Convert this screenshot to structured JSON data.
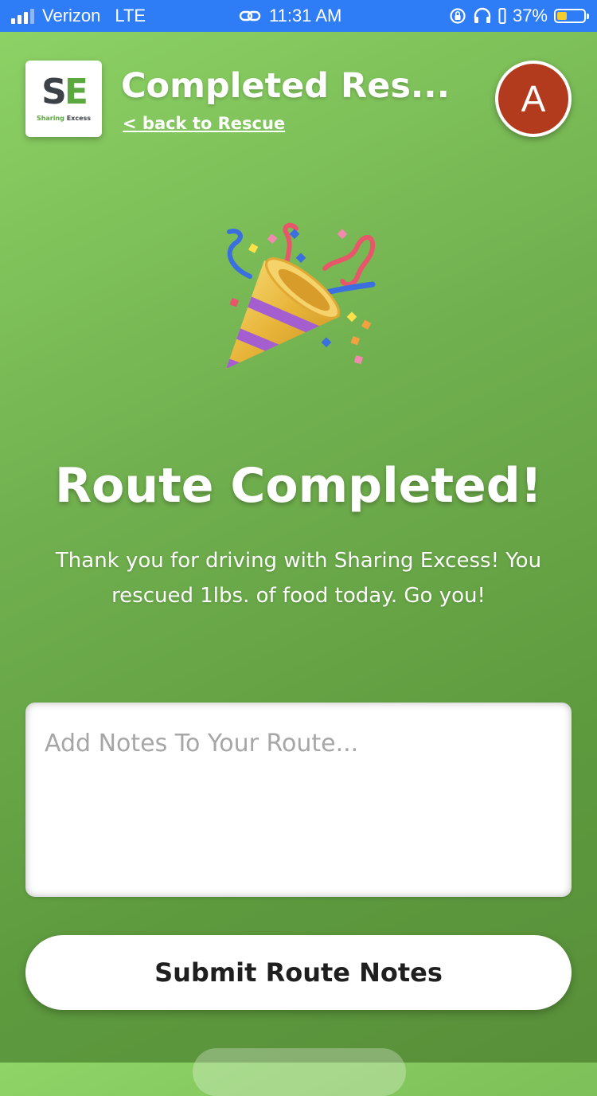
{
  "status_bar": {
    "carrier": "Verizon",
    "network": "LTE",
    "time": "11:31 AM",
    "battery": "37%",
    "battery_level": 0.37,
    "battery_color": "#f5cc2f",
    "background_color": "#2f7df6",
    "icons": [
      "signal-icon",
      "link-icon",
      "orientation-lock-icon",
      "headphones-icon",
      "battery-icon"
    ]
  },
  "header": {
    "logo": {
      "mark": "SE",
      "text_green": "Sharing",
      "text_dark": "Excess"
    },
    "title": "Completed Res...",
    "back_link": "< back to Rescue",
    "avatar_initial": "A",
    "avatar_color": "#b23a1d"
  },
  "celebration": {
    "icon": "party-popper-icon",
    "headline": "Route Completed!",
    "message": "Thank you for driving with Sharing Excess! You rescued 1lbs. of food today. Go you!"
  },
  "notes": {
    "placeholder": "Add Notes To Your Route...",
    "value": ""
  },
  "submit_button": {
    "label": "Submit Route Notes"
  },
  "theme": {
    "background_gradient": [
      "#8ed466",
      "#588f39"
    ],
    "brand_green": "#5aa83f"
  }
}
